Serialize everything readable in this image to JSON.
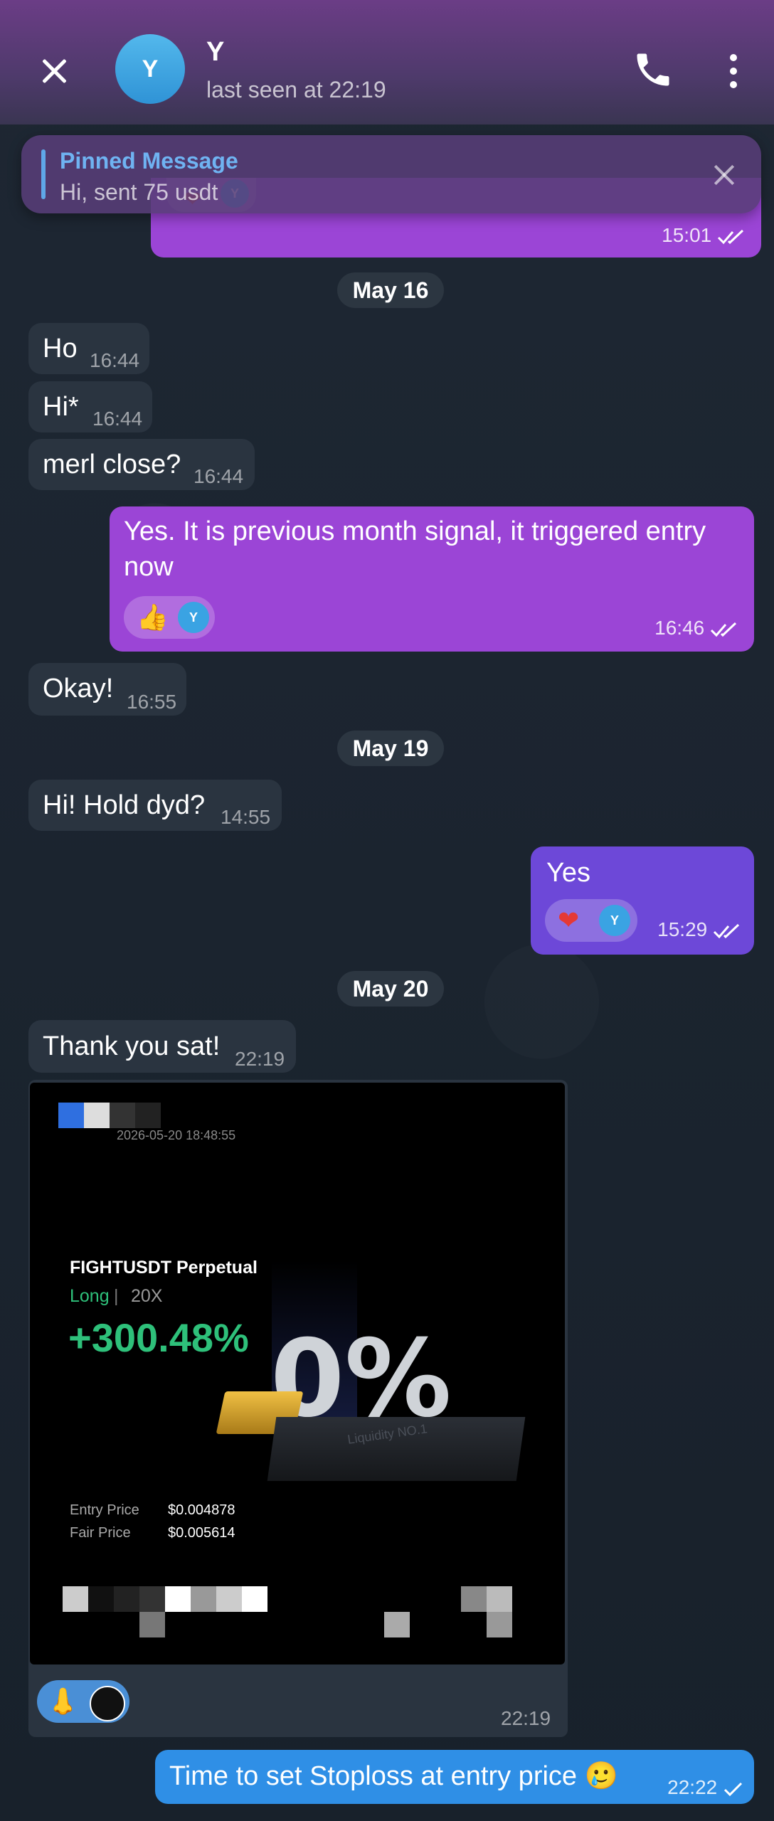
{
  "header": {
    "name": "Y",
    "avatar_letter": "Y",
    "status": "last seen at 22:19",
    "bg_color": "#5a3c78"
  },
  "pinned": {
    "title": "Pinned Message",
    "text": "Hi, sent 75 usdt"
  },
  "messages": {
    "top_out_time": "15:01",
    "date1": "May 16",
    "m1": {
      "text": "Ho",
      "time": "16:44"
    },
    "m2": {
      "text": "Hi*",
      "time": "16:44"
    },
    "m3": {
      "text": "merl close?",
      "time": "16:44"
    },
    "m4": {
      "text": "Yes. It is previous month signal, it triggered entry now",
      "time": "16:46",
      "reaction": "👍"
    },
    "m5": {
      "text": "Okay!",
      "time": "16:55"
    },
    "date2": "May 19",
    "m6": {
      "text": "Hi! Hold dyd?",
      "time": "14:55"
    },
    "m7": {
      "text": "Yes",
      "time": "15:29",
      "reaction": "❤️"
    },
    "date3": "May 20",
    "m8": {
      "text": "Thank you sat!",
      "time": "22:19"
    },
    "photo": {
      "timestamp": "2026-05-20 18:48:55",
      "pair": "FIGHTUSDT Perpetual",
      "side": "Long",
      "leverage": "20X",
      "pnl": "+300.48%",
      "entry_label": "Entry Price",
      "entry_value": "$0.004878",
      "fair_label": "Fair Price",
      "fair_value": "$0.005614",
      "promo_big": "0%",
      "promo_small": "Liquidity NO.1",
      "time": "22:19",
      "reaction": "👃"
    },
    "m9": {
      "text": "Time to set Stoploss at entry price 🥲",
      "time": "22:22"
    }
  },
  "icons": {
    "close": "close-icon",
    "phone": "phone-icon",
    "more": "more-vertical-icon",
    "checks": "double-check-icon"
  }
}
